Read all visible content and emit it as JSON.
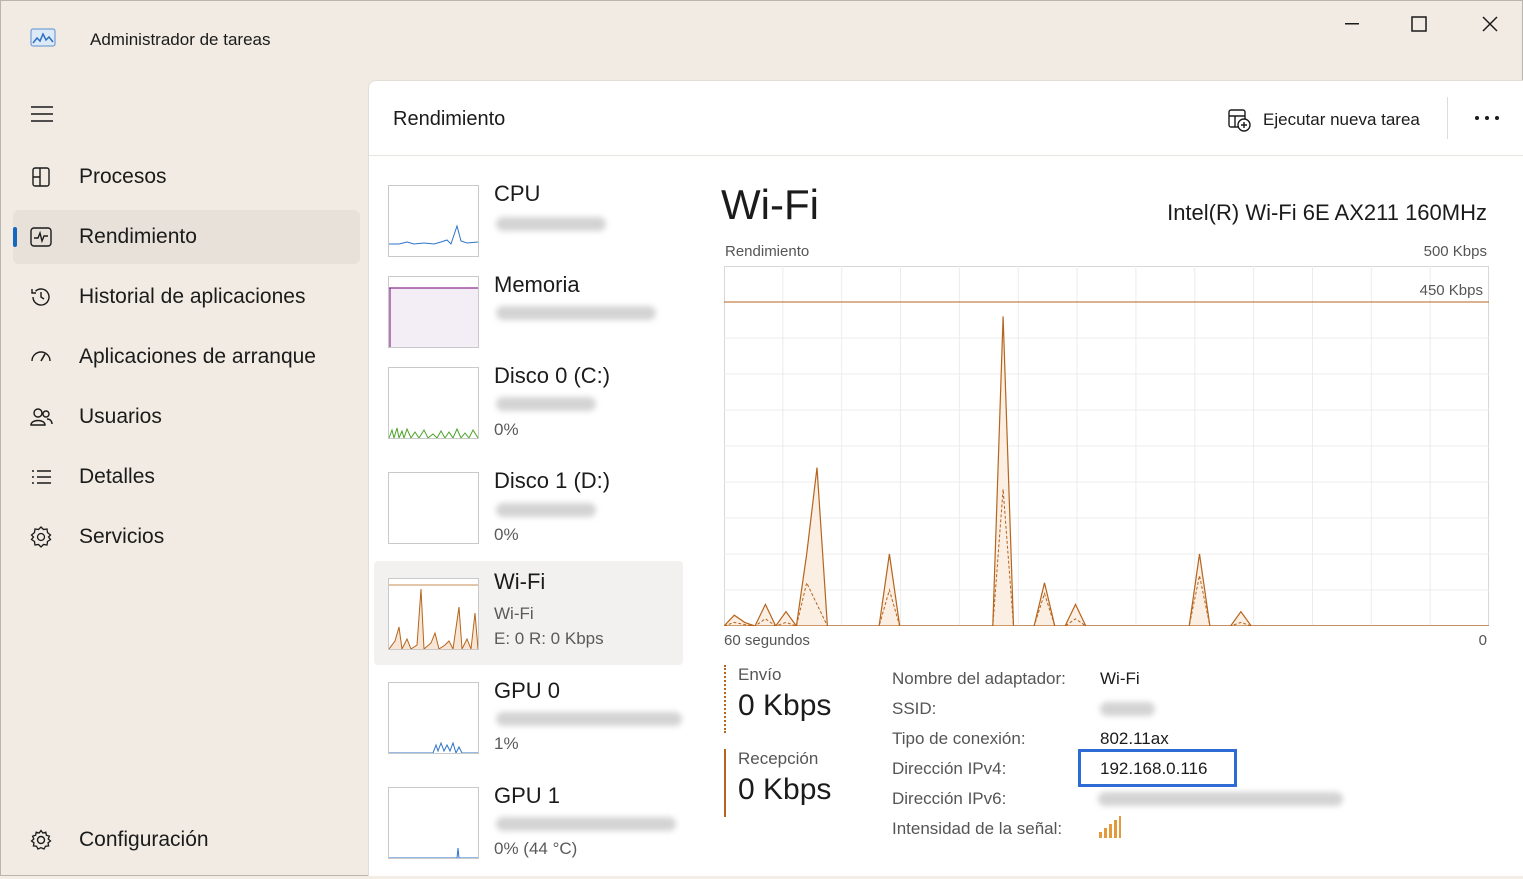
{
  "window": {
    "title": "Administrador de tareas"
  },
  "sidebar": {
    "items": [
      {
        "label": "Procesos",
        "icon": "processes-icon"
      },
      {
        "label": "Rendimiento",
        "icon": "performance-icon",
        "active": true
      },
      {
        "label": "Historial de aplicaciones",
        "icon": "history-icon"
      },
      {
        "label": "Aplicaciones de arranque",
        "icon": "startup-icon"
      },
      {
        "label": "Usuarios",
        "icon": "users-icon"
      },
      {
        "label": "Detalles",
        "icon": "details-icon"
      },
      {
        "label": "Servicios",
        "icon": "services-icon"
      }
    ],
    "settings_label": "Configuración"
  },
  "header": {
    "title": "Rendimiento",
    "run_task_label": "Ejecutar nueva tarea"
  },
  "devices": [
    {
      "name": "CPU",
      "sub1": "",
      "sub2": ""
    },
    {
      "name": "Memoria",
      "sub1": "",
      "sub2": ""
    },
    {
      "name": "Disco 0 (C:)",
      "sub1": "",
      "sub2": "0%"
    },
    {
      "name": "Disco 1 (D:)",
      "sub1": "",
      "sub2": "0%"
    },
    {
      "name": "Wi-Fi",
      "sub1": "Wi-Fi",
      "sub2": "E: 0  R: 0 Kbps"
    },
    {
      "name": "GPU 0",
      "sub1": "",
      "sub2": "1%"
    },
    {
      "name": "GPU 1",
      "sub1": "",
      "sub2": "0% (44 °C)"
    }
  ],
  "detail": {
    "title": "Wi-Fi",
    "adapter": "Intel(R) Wi-Fi 6E AX211 160MHz",
    "graph_label": "Rendimiento",
    "max_label": "500 Kbps",
    "line_label": "450 Kbps",
    "axis_left": "60 segundos",
    "axis_right": "0",
    "send_label": "Envío",
    "send_value": "0 Kbps",
    "recv_label": "Recepción",
    "recv_value": "0 Kbps",
    "props": {
      "adapter_name_label": "Nombre del adaptador:",
      "adapter_name_value": "Wi-Fi",
      "ssid_label": "SSID:",
      "conn_type_label": "Tipo de conexión:",
      "conn_type_value": "802.11ax",
      "ipv4_label": "Dirección IPv4:",
      "ipv4_value": "192.168.0.116",
      "ipv6_label": "Dirección IPv6:",
      "signal_label": "Intensidad de la señal:"
    }
  },
  "chart_data": {
    "type": "area",
    "y_unit": "Kbps",
    "ylim": [
      0,
      500
    ],
    "reference_line": 450,
    "x_range_seconds": [
      60,
      0
    ],
    "series": [
      {
        "values": [
          0,
          15,
          5,
          0,
          30,
          0,
          20,
          0,
          100,
          220,
          0,
          0,
          0,
          0,
          0,
          0,
          100,
          0,
          0,
          0,
          0,
          0,
          0,
          0,
          0,
          0,
          0,
          430,
          0,
          0,
          0,
          60,
          0,
          0,
          30,
          0,
          0,
          0,
          0,
          0,
          0,
          0,
          0,
          0,
          0,
          0,
          100,
          0,
          0,
          0,
          20,
          0,
          0,
          0,
          0,
          0,
          0,
          0,
          0,
          0,
          0,
          0,
          0,
          0,
          0,
          0,
          0,
          0,
          0,
          0,
          0,
          0,
          0,
          0,
          0
        ]
      },
      {
        "values": [
          0,
          5,
          2,
          0,
          10,
          0,
          5,
          0,
          60,
          30,
          0,
          0,
          0,
          0,
          0,
          0,
          50,
          0,
          0,
          0,
          0,
          0,
          0,
          0,
          0,
          0,
          0,
          190,
          0,
          0,
          0,
          45,
          0,
          0,
          10,
          0,
          0,
          0,
          0,
          0,
          0,
          0,
          0,
          0,
          0,
          0,
          70,
          0,
          0,
          0,
          5,
          0,
          0,
          0,
          0,
          0,
          0,
          0,
          0,
          0,
          0,
          0,
          0,
          0,
          0,
          0,
          0,
          0,
          0,
          0,
          0,
          0,
          0,
          0,
          0
        ]
      }
    ]
  },
  "colors": {
    "accent": "#b5651d",
    "nav_indicator": "#1667c0",
    "highlight_box": "#2f6bd4"
  }
}
